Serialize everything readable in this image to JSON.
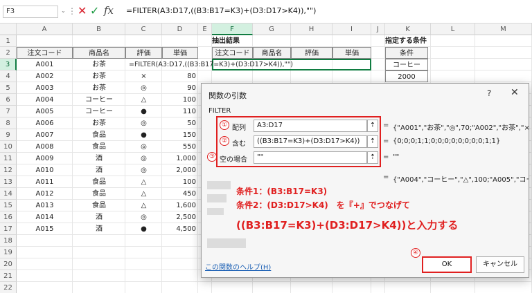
{
  "formula_bar": {
    "name_box": "F3",
    "name_box_chevron": "⌄",
    "dots": "⋮",
    "cancel_glyph": "✕",
    "enter_glyph": "✓",
    "fx_label": "fx",
    "formula": "=FILTER(A3:D17,((B3:B17=K3)+(D3:D17>K4)),\"\")"
  },
  "columns": [
    "A",
    "B",
    "C",
    "D",
    "E",
    "F",
    "G",
    "H",
    "I",
    "J",
    "K",
    "L",
    "M"
  ],
  "rows": [
    "1",
    "2",
    "3",
    "4",
    "5",
    "6",
    "7",
    "8",
    "9",
    "10",
    "11",
    "12",
    "13",
    "14",
    "15",
    "16",
    "17",
    "18",
    "19",
    "20",
    "21",
    "22"
  ],
  "table_headers": [
    "注文コード",
    "商品名",
    "評価",
    "単価"
  ],
  "table_rows": [
    [
      "A001",
      "お茶",
      "=FILTER(A3:D17,((B3:B17=K3)+(D3:D17>K4)),\"\")",
      ""
    ],
    [
      "A002",
      "お茶",
      "×",
      "80"
    ],
    [
      "A003",
      "お茶",
      "◎",
      "90"
    ],
    [
      "A004",
      "コーヒー",
      "△",
      "100"
    ],
    [
      "A005",
      "コーヒー",
      "●",
      "110"
    ],
    [
      "A006",
      "お茶",
      "◎",
      "50"
    ],
    [
      "A007",
      "食品",
      "●",
      "150"
    ],
    [
      "A008",
      "食品",
      "◎",
      "550"
    ],
    [
      "A009",
      "酒",
      "◎",
      "1,000"
    ],
    [
      "A010",
      "酒",
      "◎",
      "2,000"
    ],
    [
      "A011",
      "食品",
      "△",
      "100"
    ],
    [
      "A012",
      "食品",
      "△",
      "450"
    ],
    [
      "A013",
      "食品",
      "△",
      "1,600"
    ],
    [
      "A014",
      "酒",
      "◎",
      "2,500"
    ],
    [
      "A015",
      "酒",
      "●",
      "4,500"
    ]
  ],
  "extract": {
    "title": "抽出結果",
    "headers": [
      "注文コード",
      "商品名",
      "評価",
      "単価"
    ]
  },
  "conditions": {
    "title": "指定する条件",
    "header": "条件",
    "values": [
      "コーヒー",
      "2000"
    ]
  },
  "dialog": {
    "title": "関数の引数",
    "help_glyph": "?",
    "close_glyph": "✕",
    "function_name": "FILTER",
    "collapse_glyph": "⇡",
    "eq": "=",
    "args": [
      {
        "num": "①",
        "label": "配列",
        "value": "A3:D17",
        "result": "{\"A001\",\"お茶\",\"◎\",70;\"A002\",\"お茶\",\"×"
      },
      {
        "num": "②",
        "label": "含む",
        "value": "((B3:B17=K3)+(D3:D17>K4))",
        "result": "{0;0;0;1;1;0;0;0;0;0;0;0;0;1;1}"
      },
      {
        "num": "③",
        "label": "空の場合",
        "value": "\"\"",
        "result": "\"\""
      }
    ],
    "overall_result": "{\"A004\",\"コーヒー\",\"△\",100;\"A005\",\"コーヒ",
    "annotations": [
      "条件1：(B3:B17=K3)",
      "条件2：(D3:D17>K4)　を『+』でつなげて",
      "((B3:B17=K3)+(D3:D17>K4))と入力する"
    ],
    "ok_num": "④",
    "help_link": "この関数のヘルプ(H)",
    "ok": "OK",
    "cancel": "キャンセル"
  }
}
